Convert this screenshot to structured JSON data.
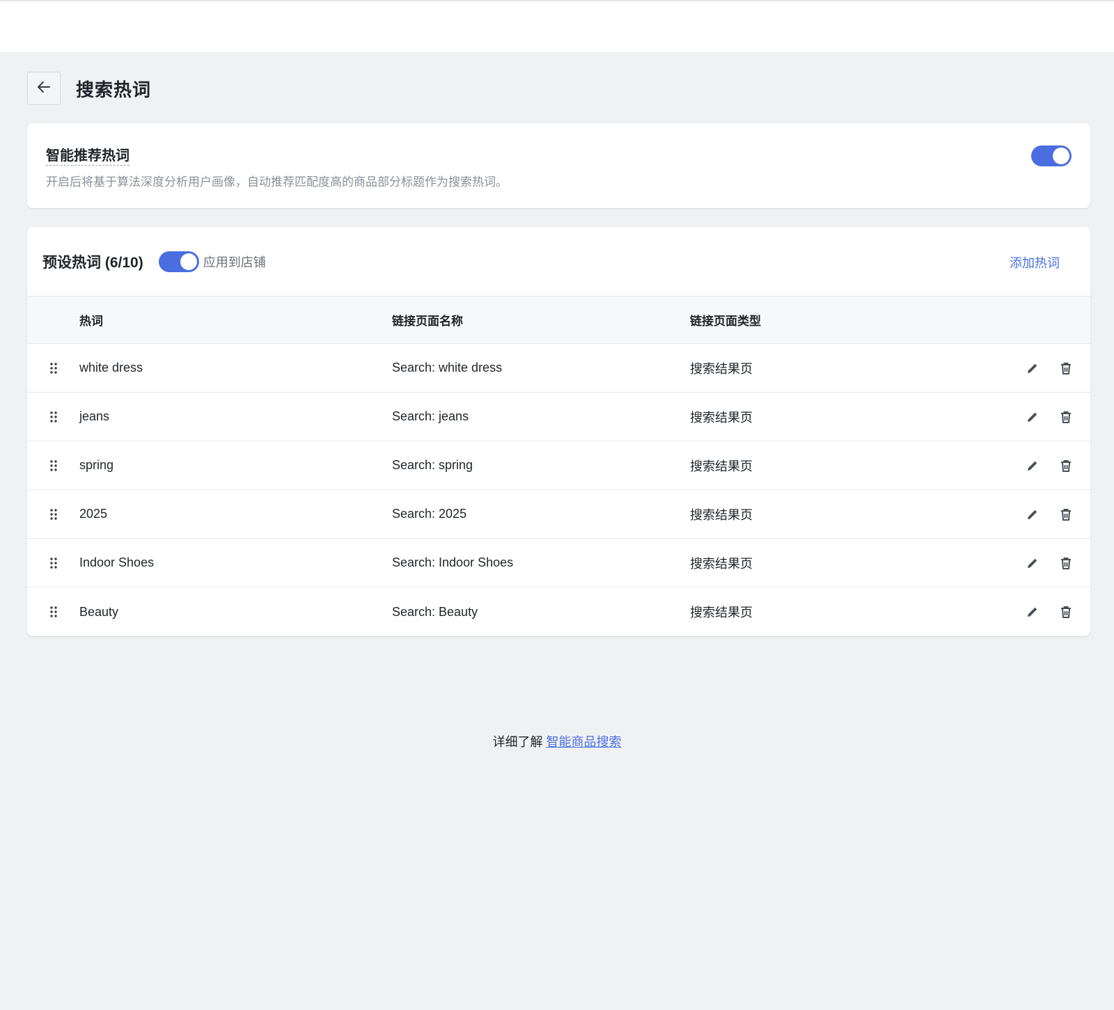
{
  "header": {
    "title": "搜索热词"
  },
  "smart": {
    "title": "智能推荐热词",
    "description": "开启后将基于算法深度分析用户画像，自动推荐匹配度高的商品部分标题作为搜索热词。",
    "enabled": true
  },
  "preset": {
    "title": "预设热词 (6/10)",
    "apply_label": "应用到店铺",
    "apply_enabled": true,
    "add_label": "添加热词",
    "columns": [
      "热词",
      "链接页面名称",
      "链接页面类型"
    ],
    "rows": [
      {
        "word": "white dress",
        "page_name": "Search: white dress",
        "page_type": "搜索结果页"
      },
      {
        "word": "jeans",
        "page_name": "Search: jeans",
        "page_type": "搜索结果页"
      },
      {
        "word": "spring",
        "page_name": "Search: spring",
        "page_type": "搜索结果页"
      },
      {
        "word": "2025",
        "page_name": "Search: 2025",
        "page_type": "搜索结果页"
      },
      {
        "word": "Indoor Shoes",
        "page_name": "Search: Indoor Shoes",
        "page_type": "搜索结果页"
      },
      {
        "word": "Beauty",
        "page_name": "Search: Beauty",
        "page_type": "搜索结果页"
      }
    ]
  },
  "footer": {
    "prefix": "详细了解 ",
    "link_label": "智能商品搜索"
  },
  "colors": {
    "accent": "#4a6ee0",
    "background": "#f0f1f3",
    "card": "#ffffff"
  },
  "icons": {
    "back": "arrow-left-icon",
    "drag": "drag-handle-icon",
    "edit": "pencil-icon",
    "delete": "trash-icon"
  }
}
